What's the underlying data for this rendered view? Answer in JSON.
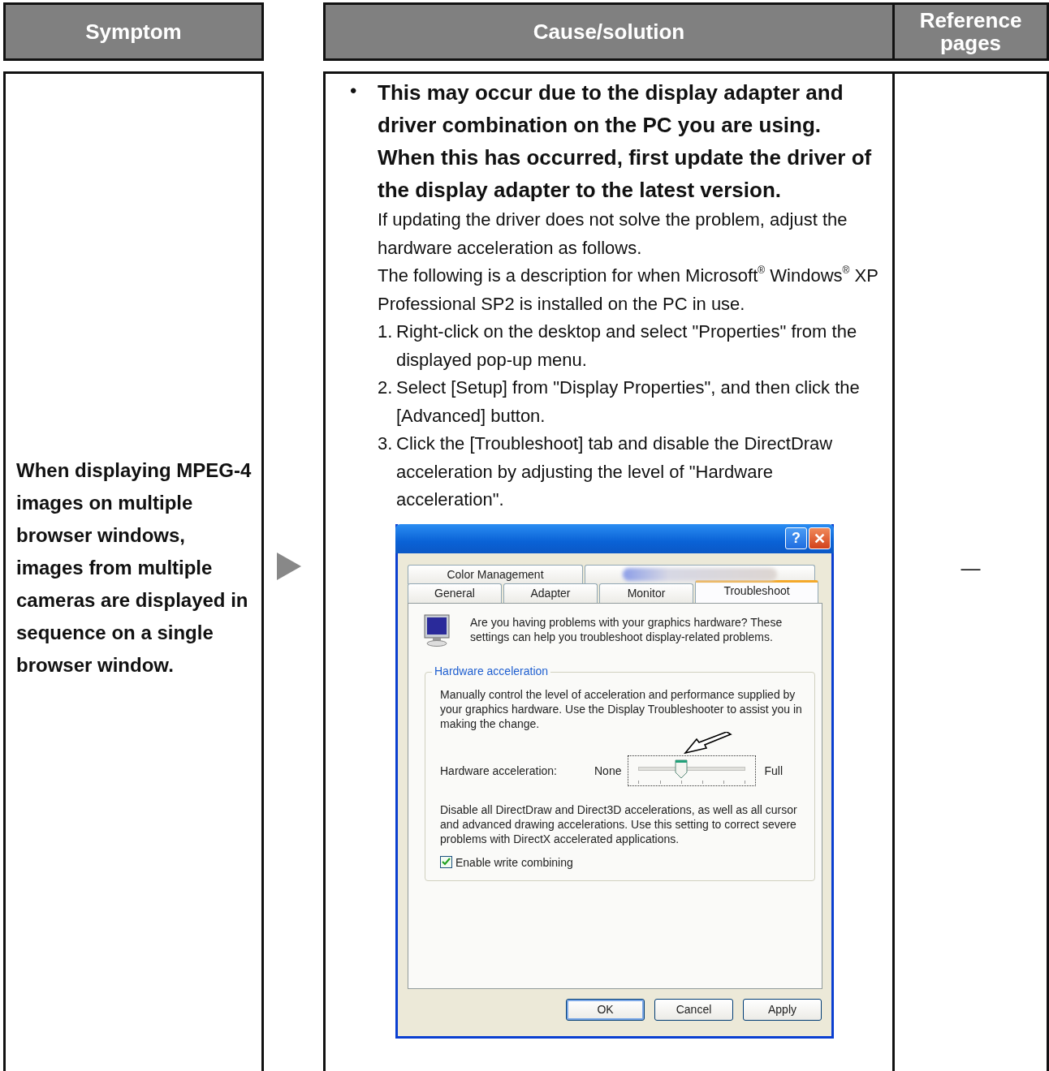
{
  "table": {
    "columns": [
      "Symptom",
      "Cause/solution",
      "Reference pages"
    ],
    "rows": [
      {
        "symptom": "When displaying MPEG-4 images on multiple browser windows, images from multiple cameras are displayed in sequence on a single browser window.",
        "bullet": "•",
        "lead": "This may occur due to the display adapter and driver combination on the PC you are using. When this has occurred, first update the driver of the display adapter to the latest version.",
        "paragraphs": [
          "If updating the driver does not solve the problem, adjust the hardware acceleration as follows.",
          "The following is a description for when Microsoft$^{®}$ Windows$^{®}$ XP Professional SP2 is installed on the PC in use."
        ],
        "steps": [
          {
            "number": "1.",
            "text": "Right-click on the desktop and select \"Properties\" from the displayed pop-up menu."
          },
          {
            "number": "2.",
            "text": "Select [Setup] from \"Display Properties\", and then click the [Advanced] button."
          },
          {
            "number": "3.",
            "text": "Click the [Troubleshoot] tab and disable the DirectDraw acceleration by adjusting the level of \"Hardware acceleration\"."
          }
        ],
        "dialog": {
          "title_buttons": [
            "?",
            "✕"
          ],
          "tab_rows": [
            [
              {
                "kind": "text",
                "label": "Color Management",
                "selected": false
              },
              {
                "kind": "blurred",
                "selected": false
              }
            ],
            [
              {
                "kind": "text",
                "label": "General",
                "selected": false
              },
              {
                "kind": "text",
                "label": "Adapter",
                "selected": false
              },
              {
                "kind": "text",
                "label": "Monitor",
                "selected": false
              },
              {
                "kind": "text",
                "label": "Troubleshoot",
                "selected": true
              }
            ]
          ],
          "intro": "Are you having problems with your graphics hardware? These settings can help you troubleshoot display-related problems.",
          "group": {
            "title": "Hardware acceleration",
            "description": "Manually control the level of acceleration and performance supplied by your graphics hardware. Use the Display Troubleshooter to assist you in making the change.",
            "slider": {
              "label": "Hardware acceleration:",
              "min_label": "None",
              "max_label": "Full",
              "level": 0.4
            },
            "setting_description": "Disable all DirectDraw and Direct3D accelerations, as well as all cursor and advanced drawing accelerations. Use this setting to correct severe problems with DirectX accelerated applications.",
            "checkbox": {
              "label": "Enable write combining",
              "checked": true
            }
          },
          "buttons": [
            "OK",
            "Cancel",
            "Apply"
          ]
        },
        "reference": "—"
      }
    ]
  }
}
